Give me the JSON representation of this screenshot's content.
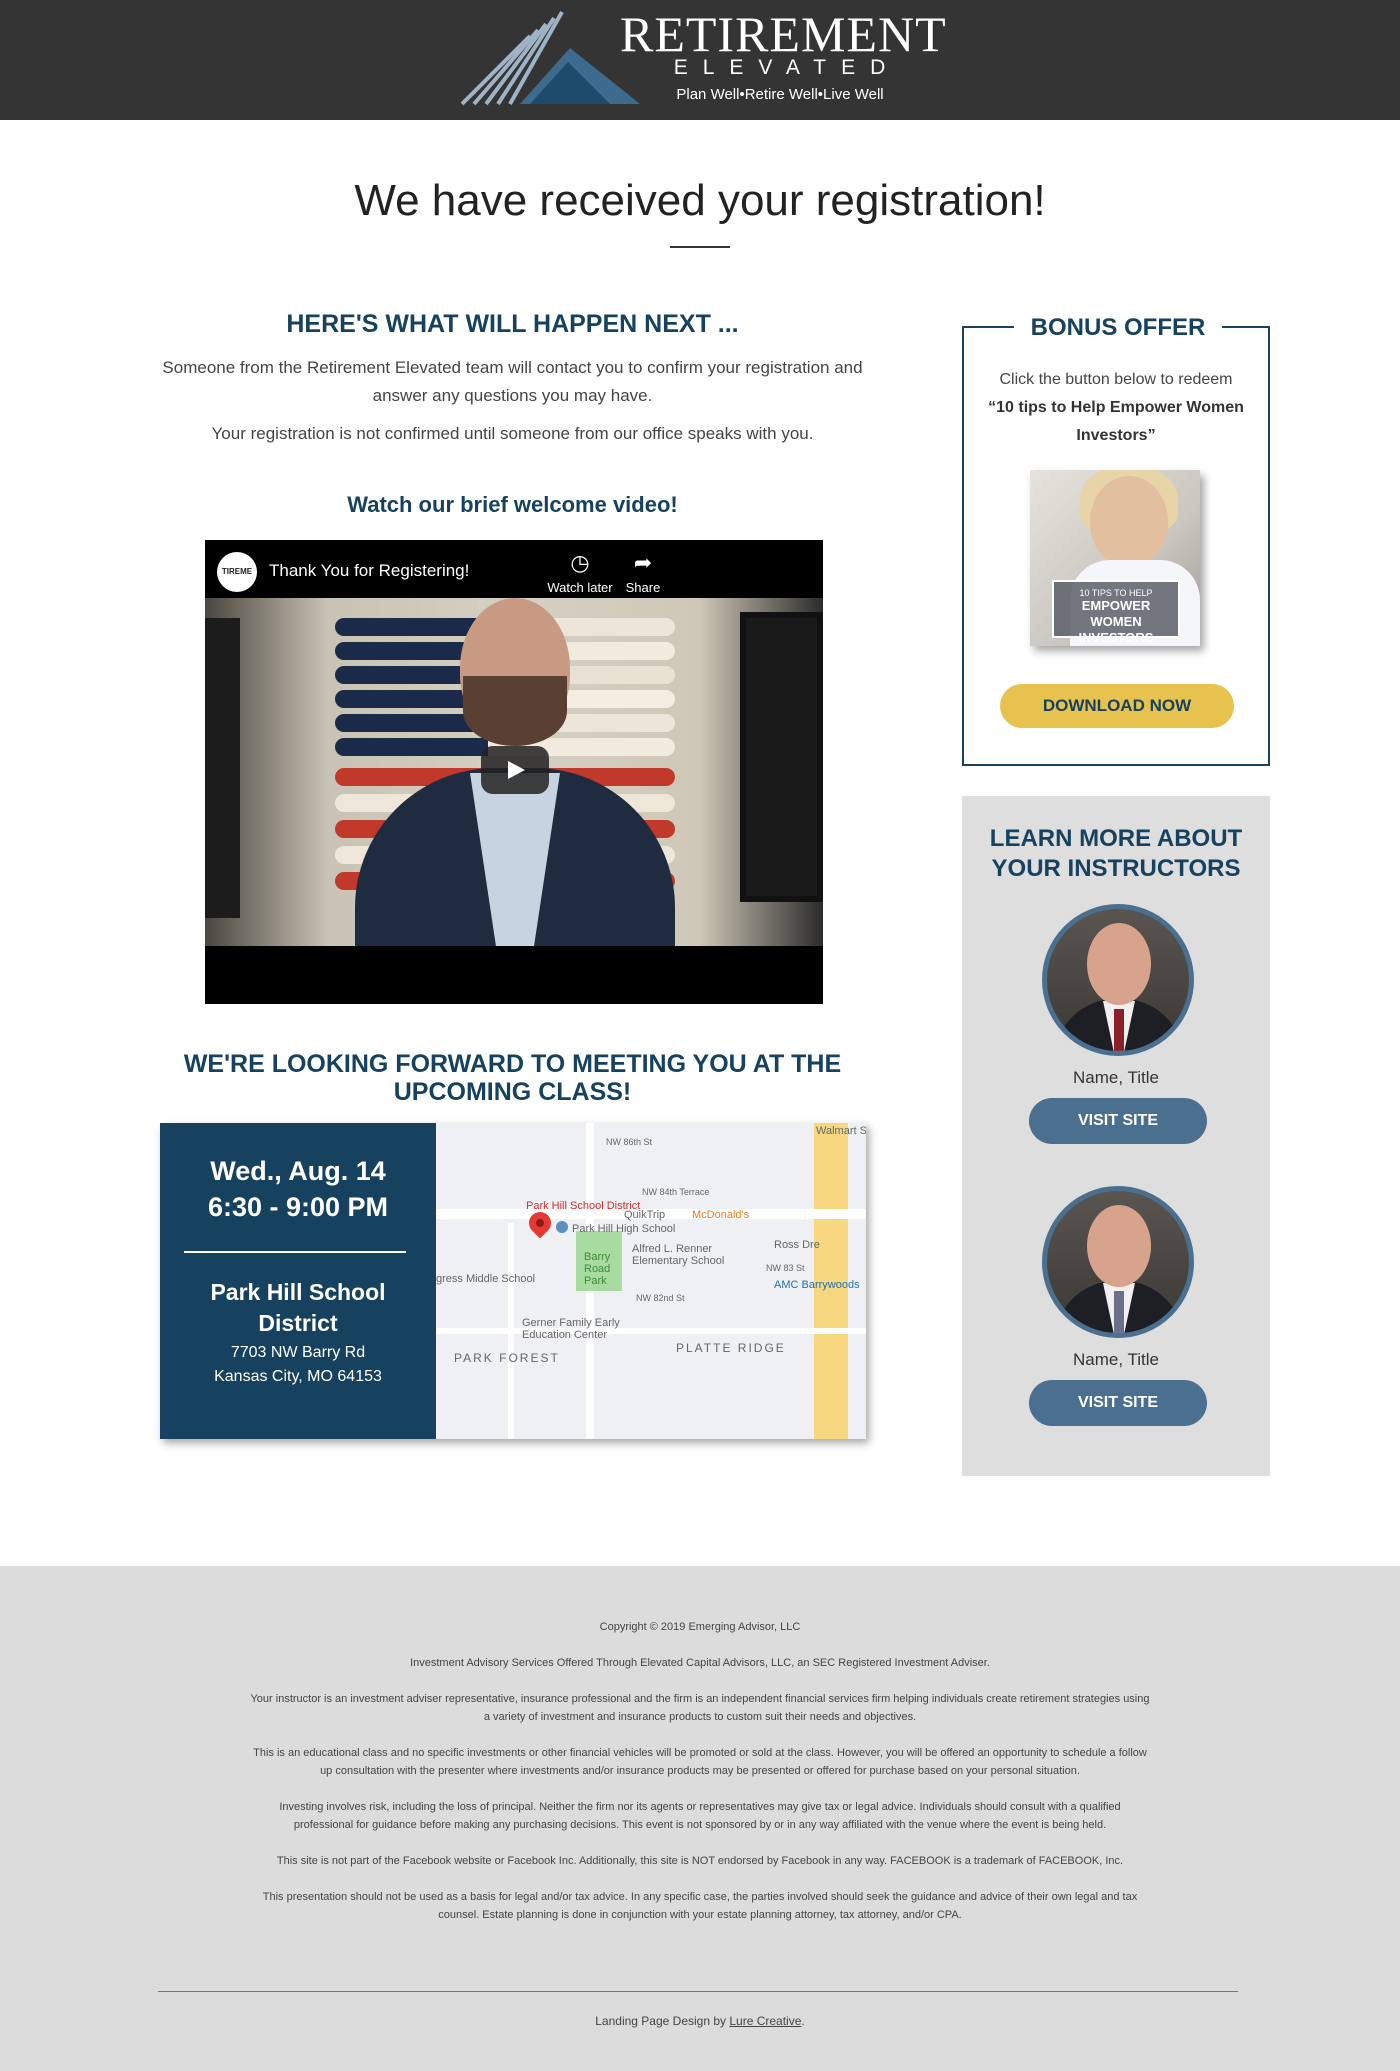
{
  "header": {
    "logo_title": "RETIREMENT",
    "logo_subtitle": "ELEVATED",
    "logo_tagline": "Plan Well•Retire Well•Live Well"
  },
  "page_title": "We have received your registration!",
  "next_steps": {
    "heading": "HERE'S WHAT WILL HAPPEN NEXT ...",
    "paragraph1": "Someone from the Retirement Elevated team will contact you to confirm your registration and answer any questions you may have.",
    "paragraph2": "Your registration is not confirmed until someone from our office speaks with you."
  },
  "video": {
    "heading": "Watch our brief welcome video!",
    "title": "Thank You for Registering!",
    "channel_avatar_text": "TIREME",
    "watch_later_label": "Watch later",
    "share_label": "Share"
  },
  "meeting": {
    "heading": "WE'RE LOOKING FORWARD TO MEETING YOU AT THE UPCOMING CLASS!",
    "date": "Wed., Aug. 14",
    "time": "6:30 - 9:00 PM",
    "venue": "Park Hill School District",
    "address_line1": "7703 NW Barry Rd",
    "address_line2": "Kansas City, MO 64153"
  },
  "map": {
    "pin_label": "Park Hill School District",
    "labels": {
      "quiktrip": "QuikTrip",
      "mcdonalds": "McDonald's",
      "high_school": "Park Hill High School",
      "renner": "Alfred L. Renner Elementary School",
      "barry_park": "Barry Road Park",
      "middle_school": "gress Middle School",
      "amc": "AMC Barrywoods",
      "gerner": "Gerner Family Early Education Center",
      "park_forest": "PARK FOREST",
      "platte_ridge": "PLATTE RIDGE",
      "walmart": "Walmart Su",
      "ross": "Ross Dre",
      "nw_84th": "NW 84th Terrace",
      "nw_83rd": "NW 83 St",
      "nw_82nd": "NW 82nd St",
      "nw_86th": "NW 86th St"
    }
  },
  "bonus": {
    "heading": "BONUS OFFER",
    "intro": "Click the button below to redeem",
    "offer_title": "“10 tips to Help Empower Women Investors”",
    "book_line1": "10 TIPS TO HELP",
    "book_line2": "EMPOWER",
    "book_line3": "WOMEN INVESTORS",
    "button_label": "DOWNLOAD NOW"
  },
  "instructors": {
    "heading": "LEARN MORE ABOUT YOUR INSTRUCTORS",
    "items": [
      {
        "name": "Name, Title",
        "button_label": "VISIT SITE"
      },
      {
        "name": "Name, Title",
        "button_label": "VISIT SITE"
      }
    ]
  },
  "footer": {
    "copyright": "Copyright © 2019 Emerging Advisor, LLC",
    "notes": [
      "Investment Advisory Services Offered Through Elevated Capital Advisors, LLC, an SEC Registered Investment Adviser.",
      "Your instructor is an investment adviser representative, insurance professional and the firm is an independent financial services firm helping individuals create retirement strategies using a variety of investment and insurance products to custom suit their needs and objectives.",
      "This is an educational class and no specific investments or other financial vehicles will be promoted or sold at the class. However, you will be offered an opportunity to schedule a follow up consultation with the presenter where investments and/or insurance products may be presented or offered for purchase based on your personal situation.",
      "Investing involves risk, including the loss of principal. Neither the firm nor its agents or representatives may give tax or legal advice. Individuals should consult with a qualified professional for guidance before making any purchasing decisions. This event is not sponsored by or in any way affiliated with the venue where the event is being held.",
      "This site is not part of the Facebook website or Facebook Inc. Additionally, this site is NOT endorsed by Facebook in any way. FACEBOOK is a trademark of FACEBOOK, Inc.",
      "This presentation should not be used as a basis for legal and/or tax advice. In any specific case, the parties involved should seek the guidance and advice of their own legal and tax counsel. Estate planning is done in conjunction with your estate planning attorney, tax attorney, and/or CPA."
    ],
    "credit_prefix": "Landing Page Design by ",
    "credit_link": "Lure Creative",
    "credit_suffix": "."
  },
  "colors": {
    "brand_navy": "#16425f",
    "header_bg": "#343434",
    "gold": "#e8c24f",
    "steel_blue": "#4a6f8f",
    "panel_gray": "#dedede"
  }
}
